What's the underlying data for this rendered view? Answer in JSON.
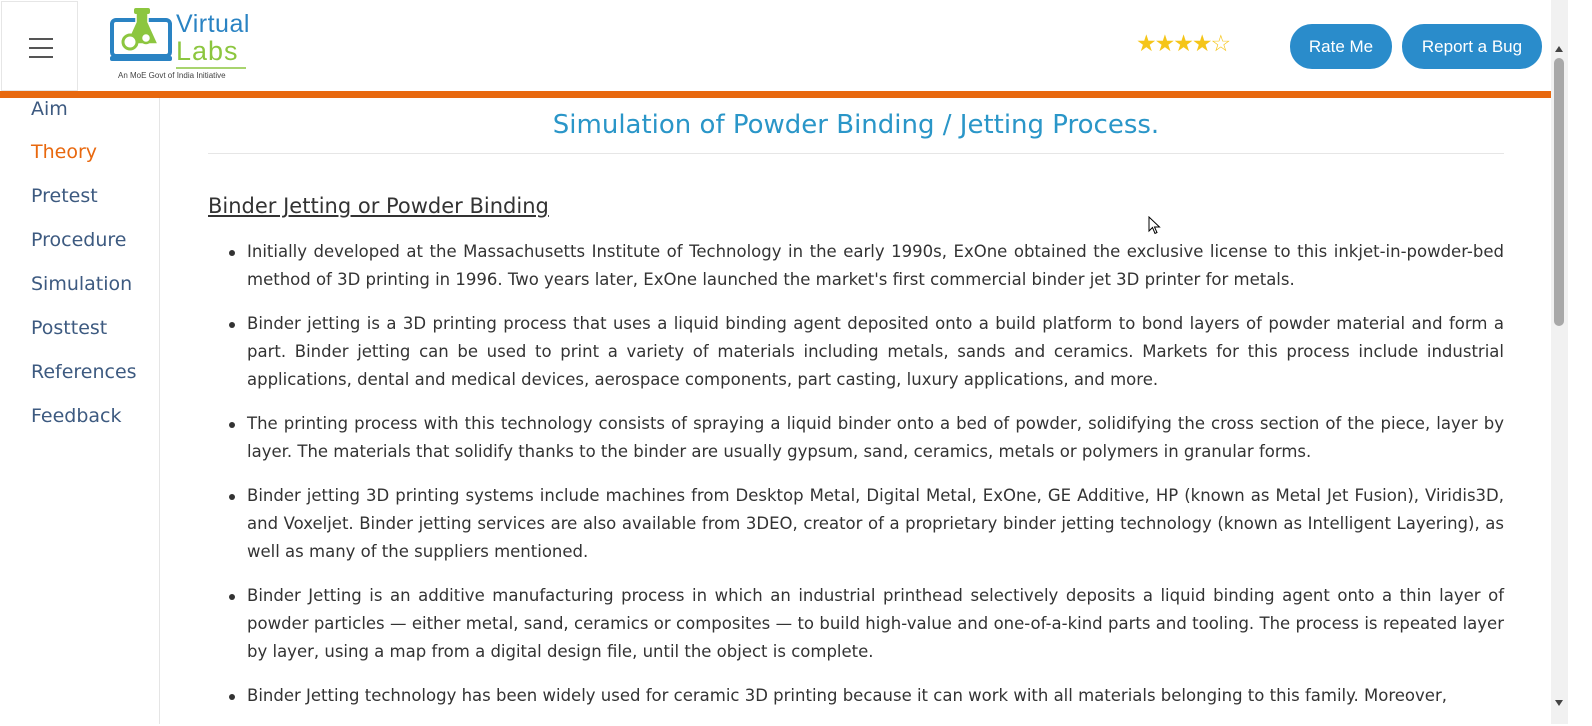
{
  "header": {
    "logo": {
      "word1": "Virtual",
      "word2": "Labs",
      "tagline": "An MoE Govt of India Initiative"
    },
    "rating": {
      "value": 4,
      "max": 5
    },
    "rate_button": "Rate Me",
    "bug_button": "Report a Bug"
  },
  "sidebar": {
    "items": [
      {
        "label": "Aim",
        "active": false
      },
      {
        "label": "Theory",
        "active": true
      },
      {
        "label": "Pretest",
        "active": false
      },
      {
        "label": "Procedure",
        "active": false
      },
      {
        "label": "Simulation",
        "active": false
      },
      {
        "label": "Posttest",
        "active": false
      },
      {
        "label": "References",
        "active": false
      },
      {
        "label": "Feedback",
        "active": false
      }
    ]
  },
  "main": {
    "title": "Simulation of Powder Binding / Jetting Process.",
    "section_heading": "Binder Jetting or Powder Binding",
    "bullets": [
      "Initially developed at the Massachusetts Institute of Technology in the early 1990s, ExOne obtained the exclusive license to this inkjet-in-powder-bed method of 3D printing in 1996. Two years later, ExOne launched the market's first commercial binder jet 3D printer for metals.",
      "Binder jetting is a 3D printing process that uses a liquid binding agent deposited onto a build platform to bond layers of powder material and form a part. Binder jetting can be used to print a variety of materials including metals, sands and ceramics. Markets for this process include industrial applications, dental and medical devices, aerospace components, part casting, luxury applications, and more.",
      "The printing process with this technology consists of spraying a liquid binder onto a bed of powder, solidifying the cross section of the piece, layer by layer. The materials that solidify thanks to the binder are usually gypsum, sand, ceramics, metals or polymers in granular forms.",
      "Binder jetting 3D printing systems include machines from Desktop Metal, Digital Metal, ExOne, GE Additive, HP (known as Metal Jet Fusion), Viridis3D, and Voxeljet. Binder jetting services are also available from 3DEO, creator of a proprietary binder jetting technology (known as Intelligent Layering), as well as many of the suppliers mentioned.",
      "Binder Jetting is an additive manufacturing process in which an industrial printhead selectively deposits a liquid binding agent onto a thin layer of powder particles — either metal, sand, ceramics or composites — to build high-value and one-of-a-kind parts and tooling. The process is repeated layer by layer, using a map from a digital design file, until the object is complete.",
      "Binder Jetting technology has been widely used for ceramic 3D printing because it can work with all materials belonging to this family. Moreover,"
    ]
  },
  "colors": {
    "accent_orange": "#e8680e",
    "button_blue": "#2a8ccb",
    "title_blue": "#2a96c8",
    "nav_text": "#3d5a80",
    "star": "#f5c518"
  }
}
